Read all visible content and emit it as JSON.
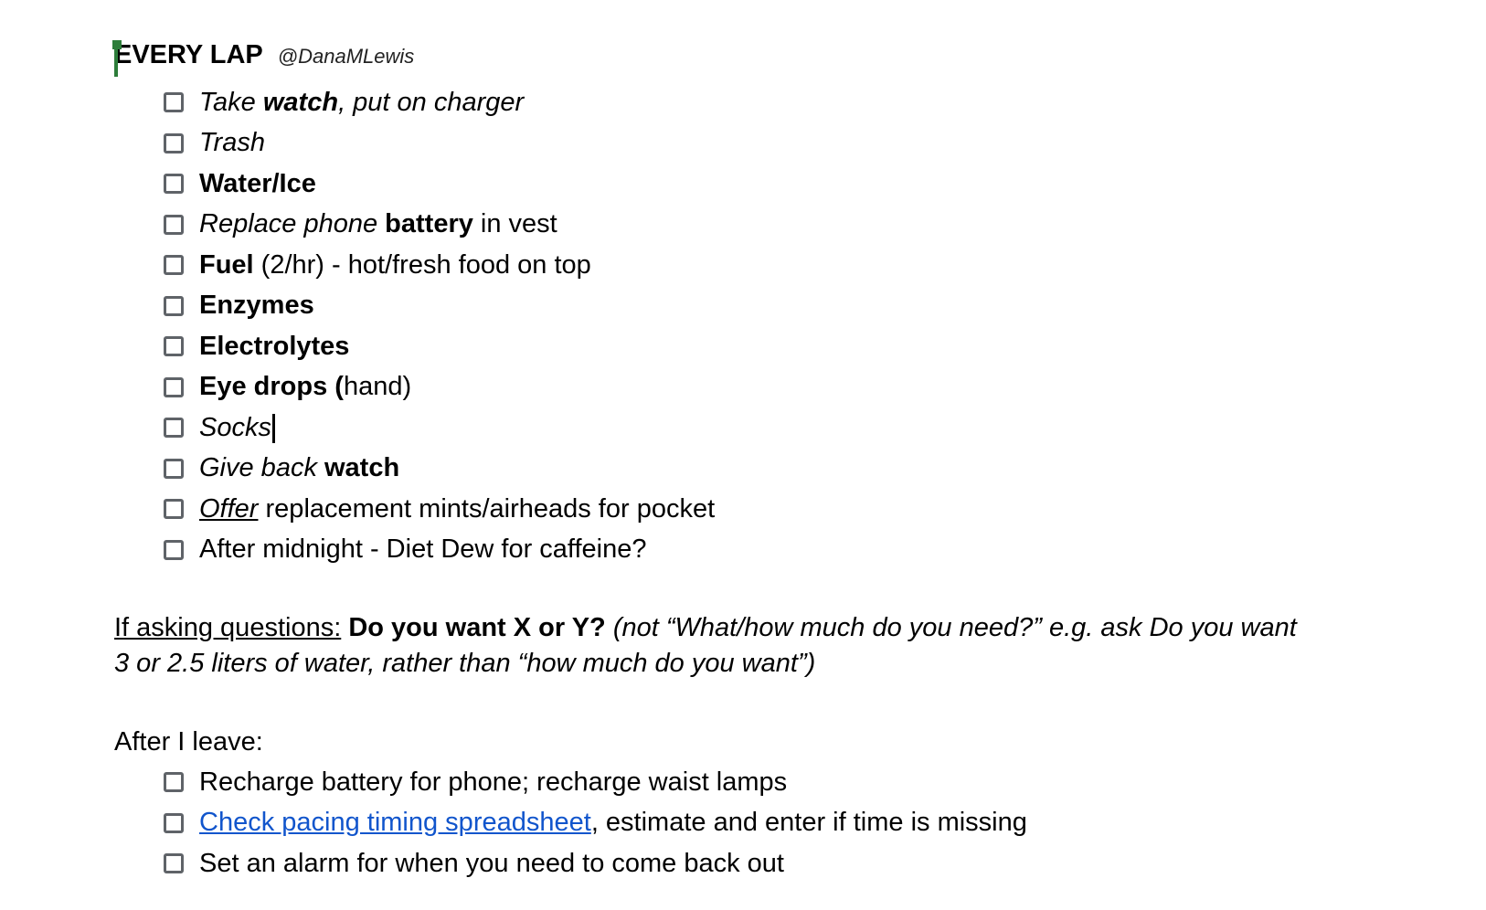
{
  "heading": {
    "title": "EVERY LAP",
    "mention": "@DanaMLewis"
  },
  "every_lap": [
    {
      "parts": [
        {
          "t": "Take ",
          "s": "i"
        },
        {
          "t": "watch",
          "s": "i b"
        },
        {
          "t": ", put on charger",
          "s": "i"
        }
      ]
    },
    {
      "parts": [
        {
          "t": "Trash",
          "s": "i"
        }
      ]
    },
    {
      "parts": [
        {
          "t": "Water/Ice",
          "s": "b"
        }
      ]
    },
    {
      "parts": [
        {
          "t": "Replace phone ",
          "s": "i"
        },
        {
          "t": "battery",
          "s": "b"
        },
        {
          "t": " in vest",
          "s": ""
        }
      ]
    },
    {
      "parts": [
        {
          "t": "Fuel",
          "s": "b"
        },
        {
          "t": " (2/hr) - hot/fresh food on top",
          "s": ""
        }
      ]
    },
    {
      "parts": [
        {
          "t": "Enzymes",
          "s": "b"
        }
      ]
    },
    {
      "parts": [
        {
          "t": "Electrolytes",
          "s": "b"
        }
      ]
    },
    {
      "parts": [
        {
          "t": "Eye drops (",
          "s": "b"
        },
        {
          "t": "hand)",
          "s": ""
        }
      ]
    },
    {
      "parts": [
        {
          "t": "Socks",
          "s": "i"
        }
      ],
      "caret": true
    },
    {
      "parts": [
        {
          "t": "Give back ",
          "s": "i"
        },
        {
          "t": "watch",
          "s": "b"
        }
      ]
    },
    {
      "parts": [
        {
          "t": "Offer",
          "s": "i u"
        },
        {
          "t": " replacement mints/airheads for pocket",
          "s": ""
        }
      ]
    },
    {
      "parts": [
        {
          "t": "After midnight - Diet Dew for caffeine?",
          "s": ""
        }
      ]
    }
  ],
  "questions": {
    "label": "If asking questions:",
    "bold": " Do you want X or Y?",
    "note": " (not “What/how much do you need?” e.g. ask Do you want 3 or 2.5 liters of water, rather than “how much do you want”)"
  },
  "after_leave": {
    "label": "After I leave:",
    "items": [
      {
        "parts": [
          {
            "t": "Recharge battery for phone; recharge waist lamps",
            "s": ""
          }
        ]
      },
      {
        "parts": [
          {
            "t": "Check pacing timing spreadsheet",
            "s": "link"
          },
          {
            "t": ", estimate and enter if time is missing",
            "s": ""
          }
        ]
      },
      {
        "parts": [
          {
            "t": "Set an alarm for when you need to come back out",
            "s": ""
          }
        ]
      }
    ]
  },
  "colors": {
    "link": "#1155cc",
    "cursor": "#2d7d3a",
    "checkbox": "#5f6368"
  }
}
